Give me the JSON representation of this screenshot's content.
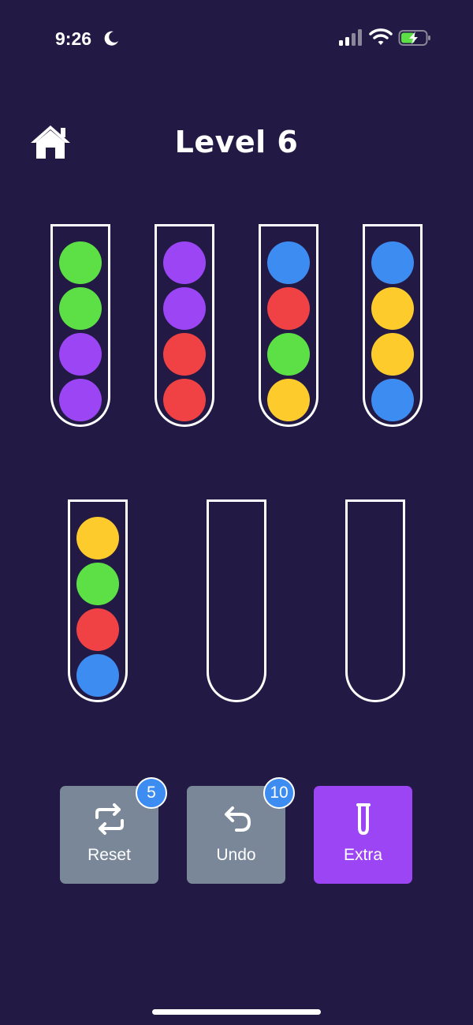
{
  "status_bar": {
    "time": "9:26",
    "moon_icon": "moon-icon",
    "signal_icon": "cellular-signal-icon",
    "wifi_icon": "wifi-icon",
    "battery_icon": "battery-charging-icon"
  },
  "header": {
    "home_icon": "home-icon",
    "level_title": "Level 6"
  },
  "colors": {
    "background": "#221a44",
    "green": "#5ce045",
    "purple": "#9b45f5",
    "blue": "#3d8cf2",
    "red": "#f04245",
    "yellow": "#fdcb2c",
    "button_gray": "#7a8799",
    "button_purple": "#9b45f5"
  },
  "tubes": [
    {
      "balls": [
        "green",
        "green",
        "purple",
        "purple"
      ]
    },
    {
      "balls": [
        "purple",
        "purple",
        "red",
        "red"
      ]
    },
    {
      "balls": [
        "blue",
        "red",
        "green",
        "yellow"
      ]
    },
    {
      "balls": [
        "blue",
        "yellow",
        "yellow",
        "blue"
      ]
    },
    {
      "balls": [
        "yellow",
        "green",
        "red",
        "blue"
      ]
    },
    {
      "balls": []
    },
    {
      "balls": []
    }
  ],
  "buttons": {
    "reset": {
      "label": "Reset",
      "badge": "5",
      "icon": "repeat-icon"
    },
    "undo": {
      "label": "Undo",
      "badge": "10",
      "icon": "undo-arrow-icon"
    },
    "extra": {
      "label": "Extra",
      "icon": "test-tube-icon"
    }
  }
}
